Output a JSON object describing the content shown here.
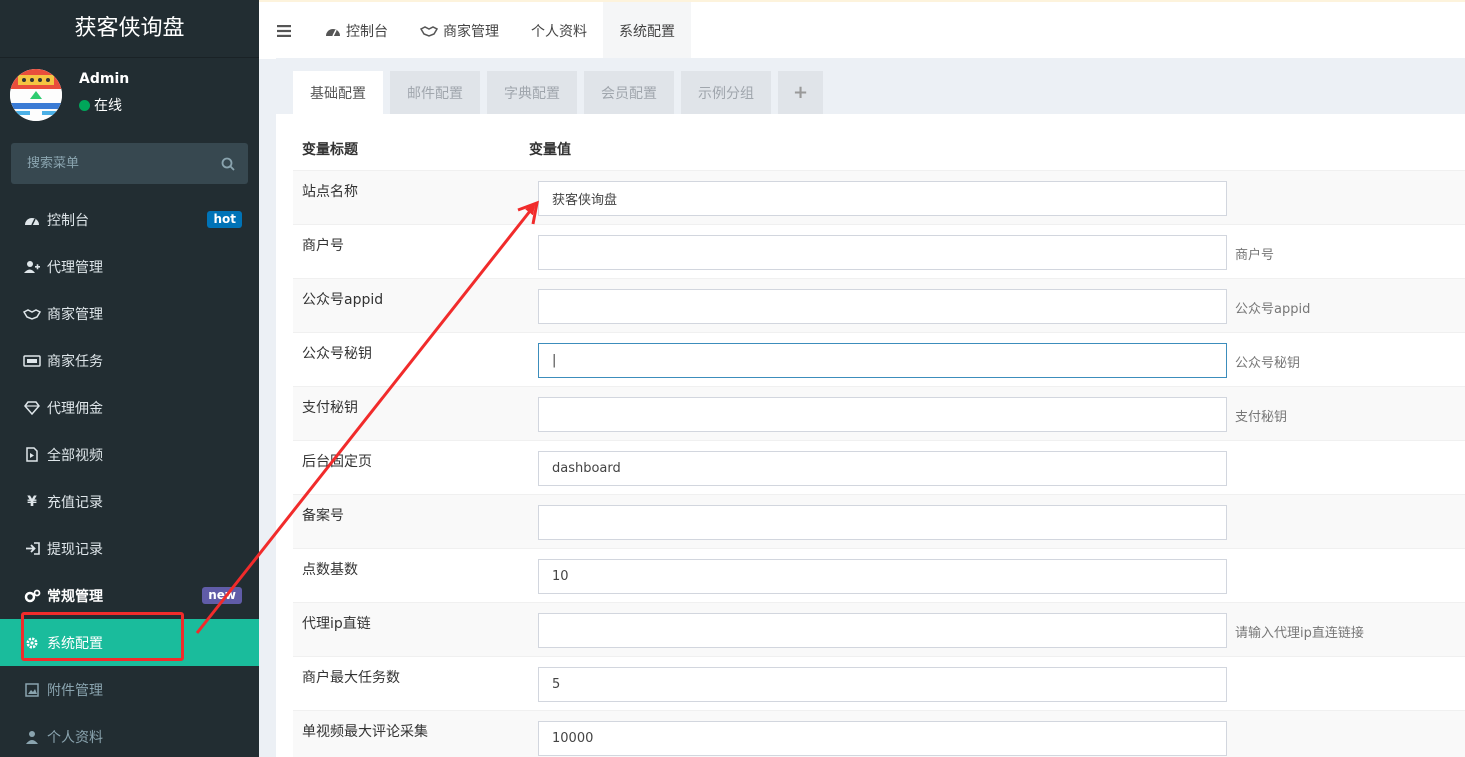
{
  "app": {
    "logo": "获客侠询盘"
  },
  "user": {
    "name": "Admin",
    "status": "在线"
  },
  "search": {
    "placeholder": "搜索菜单"
  },
  "sidebar": {
    "items": [
      {
        "label": "控制台",
        "icon": "dashboard-icon",
        "badge": "hot"
      },
      {
        "label": "代理管理",
        "icon": "user-plus-icon"
      },
      {
        "label": "商家管理",
        "icon": "handshake-icon"
      },
      {
        "label": "商家任务",
        "icon": "keyboard-icon"
      },
      {
        "label": "代理佣金",
        "icon": "diamond-icon"
      },
      {
        "label": "全部视频",
        "icon": "file-video-icon"
      },
      {
        "label": "充值记录",
        "icon": "yen-icon"
      },
      {
        "label": "提现记录",
        "icon": "sign-in-icon"
      },
      {
        "label": "常规管理",
        "icon": "cogs-icon",
        "badge": "new"
      },
      {
        "label": "系统配置",
        "icon": "gear-icon",
        "active": true
      },
      {
        "label": "附件管理",
        "icon": "image-icon"
      },
      {
        "label": "个人资料",
        "icon": "user-icon"
      }
    ]
  },
  "topbar": {
    "tabs": [
      {
        "label": "控制台",
        "icon": "dashboard-icon"
      },
      {
        "label": "商家管理",
        "icon": "handshake-icon"
      },
      {
        "label": "个人资料"
      },
      {
        "label": "系统配置",
        "active": true
      }
    ]
  },
  "config_tabs": [
    "基础配置",
    "邮件配置",
    "字典配置",
    "会员配置",
    "示例分组",
    "+"
  ],
  "table": {
    "headers": [
      "变量标题",
      "变量值"
    ],
    "rows": [
      {
        "label": "站点名称",
        "value": "获客侠询盘",
        "help": ""
      },
      {
        "label": "商户号",
        "value": "",
        "help": "商户号"
      },
      {
        "label": "公众号appid",
        "value": "",
        "help": "公众号appid"
      },
      {
        "label": "公众号秘钥",
        "value": "|",
        "help": "公众号秘钥"
      },
      {
        "label": "支付秘钥",
        "value": "",
        "help": "支付秘钥"
      },
      {
        "label": "后台固定页",
        "value": "dashboard",
        "help": ""
      },
      {
        "label": "备案号",
        "value": "",
        "help": ""
      },
      {
        "label": "点数基数",
        "value": "10",
        "help": ""
      },
      {
        "label": "代理ip直链",
        "value": "",
        "help": "请输入代理ip直连链接"
      },
      {
        "label": "商户最大任务数",
        "value": "5",
        "help": ""
      },
      {
        "label": "单视频最大评论采集",
        "value": "10000",
        "help": ""
      }
    ]
  },
  "colors": {
    "sidebar": "#222d32",
    "active": "#1abc9c",
    "annotation": "#f12b2b"
  }
}
